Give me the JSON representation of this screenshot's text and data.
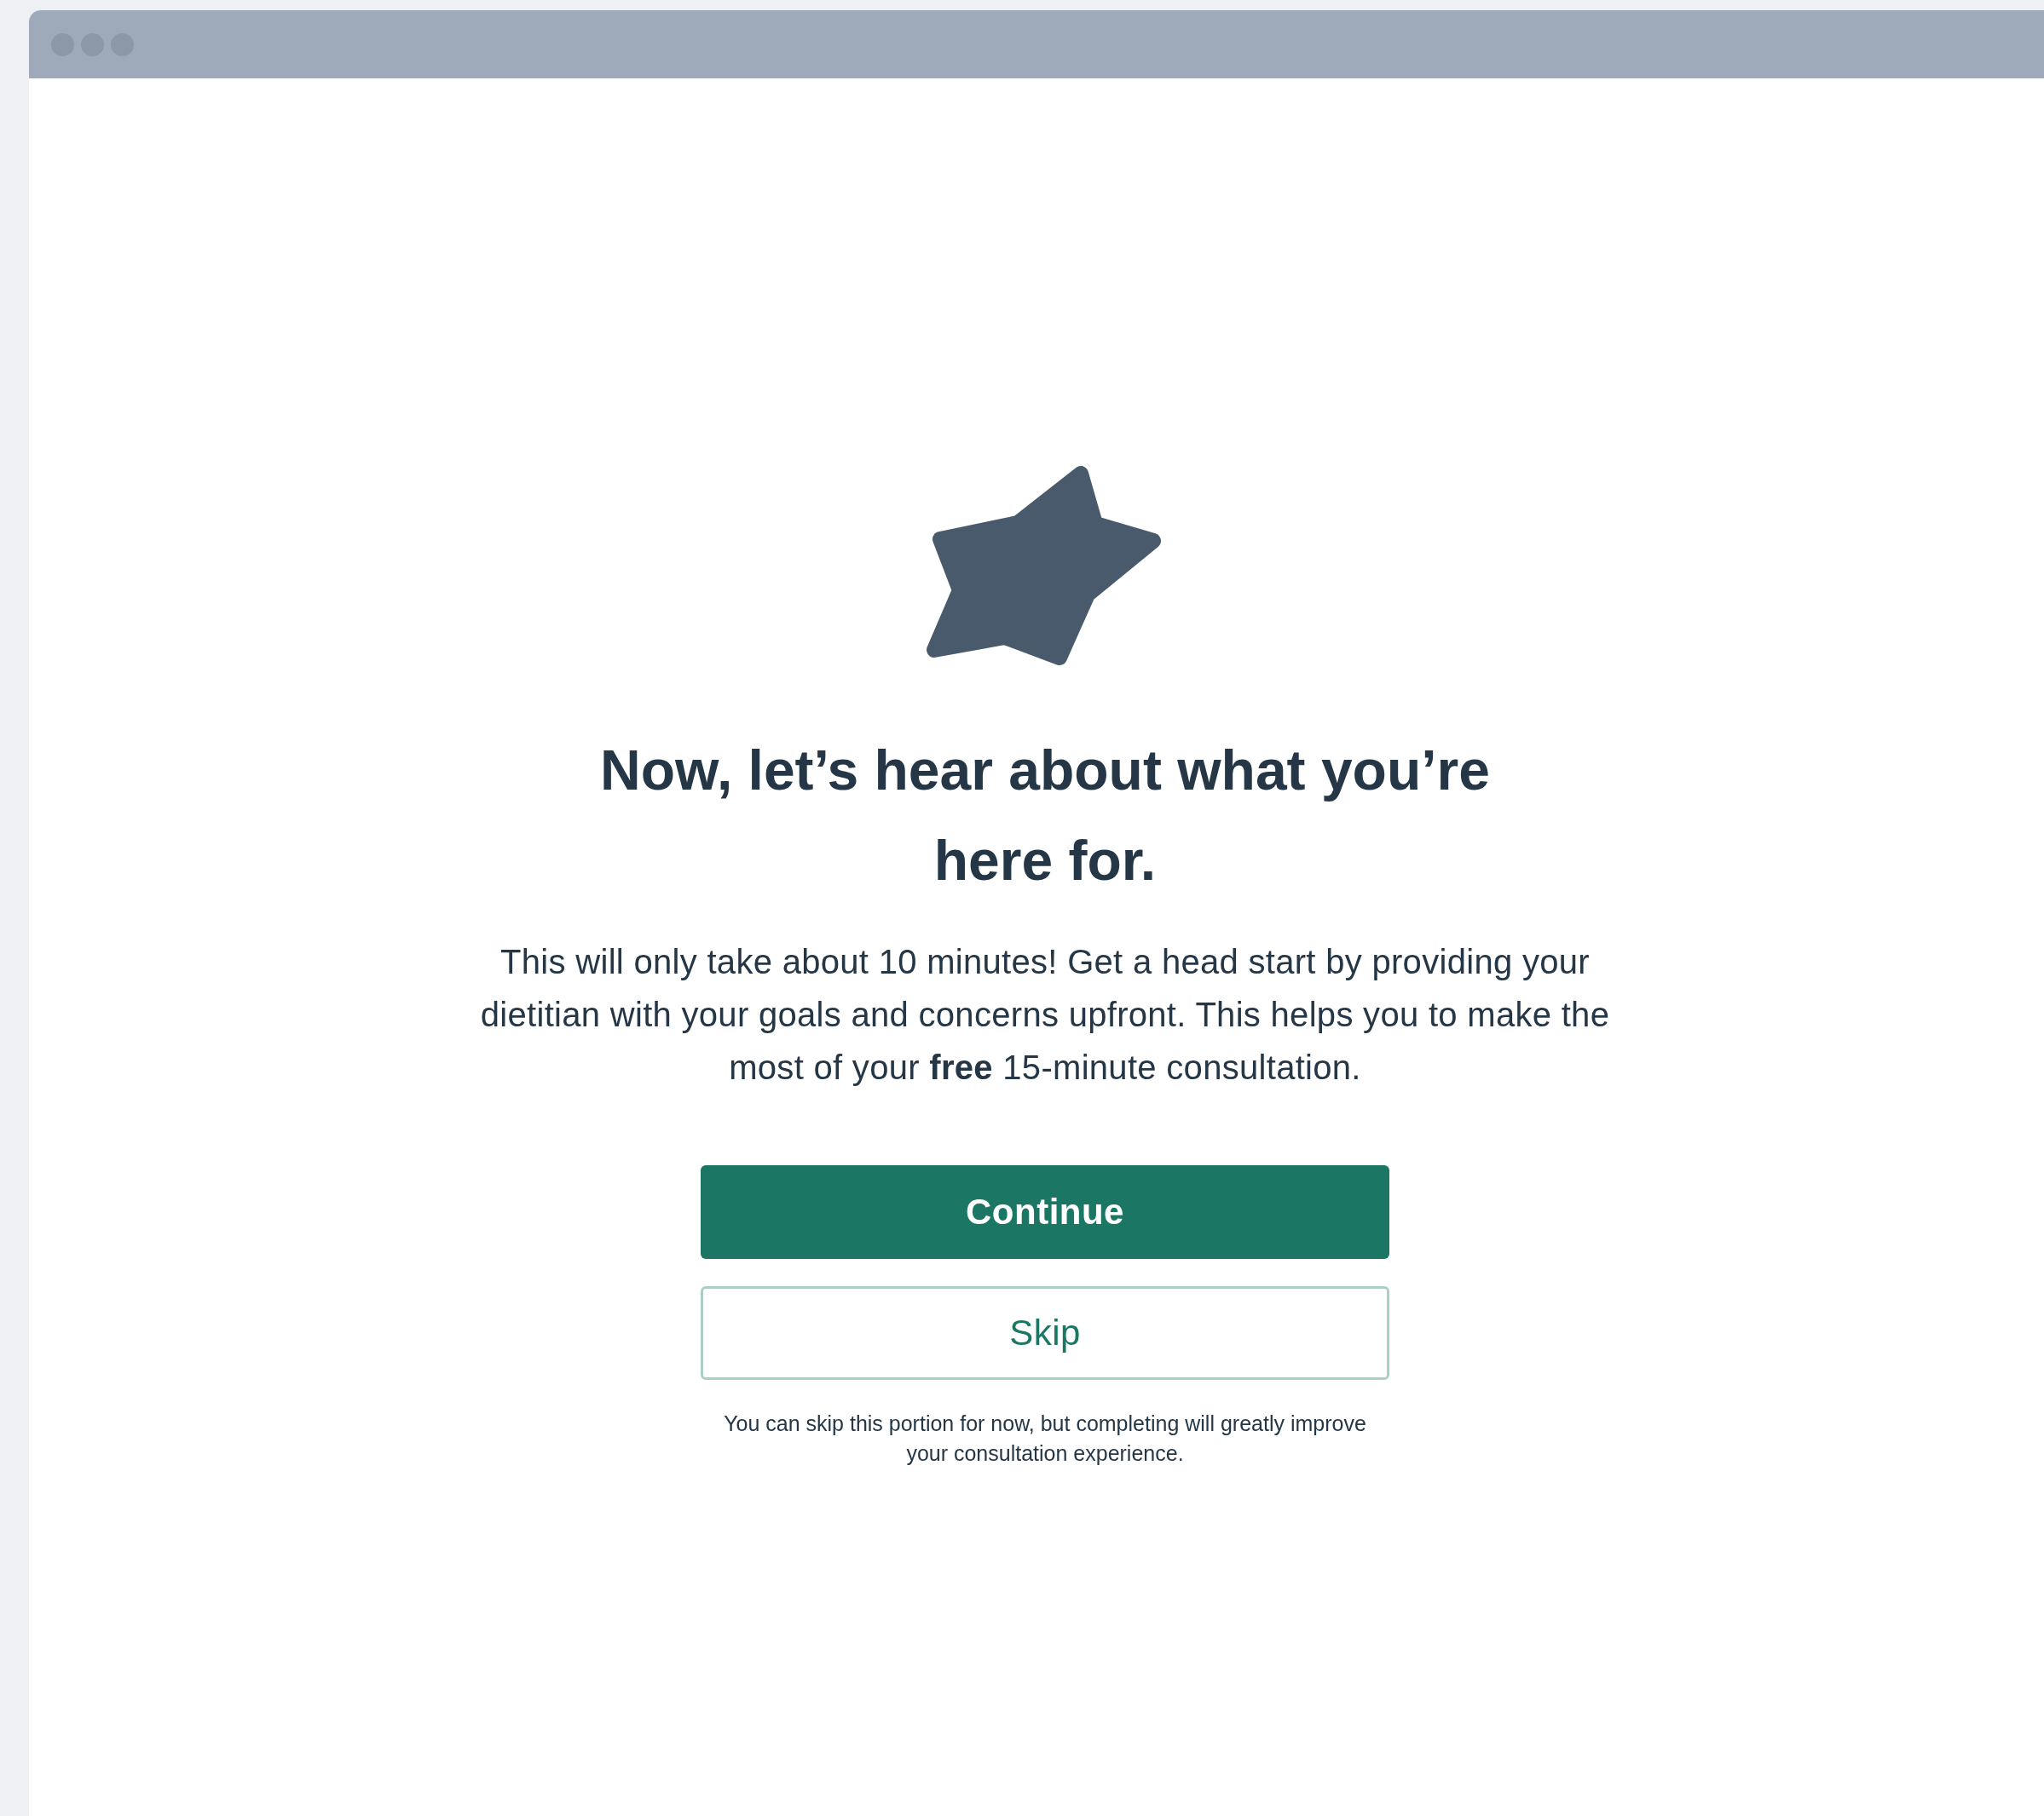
{
  "heading": "Now, let’s hear about what you’re here for.",
  "intro": "This will only take about 10 minutes! Get a head start by providing your dietitian with your goals and concerns upfront. This helps you to make the most of your **free** 15-minute consultation.",
  "buttons": [
    {
      "label": "Continue",
      "kind": "primary"
    },
    {
      "label": "Skip",
      "kind": "secondary"
    }
  ],
  "note": "You can skip this portion for now, but completing will greatly improve your consultation experience."
}
